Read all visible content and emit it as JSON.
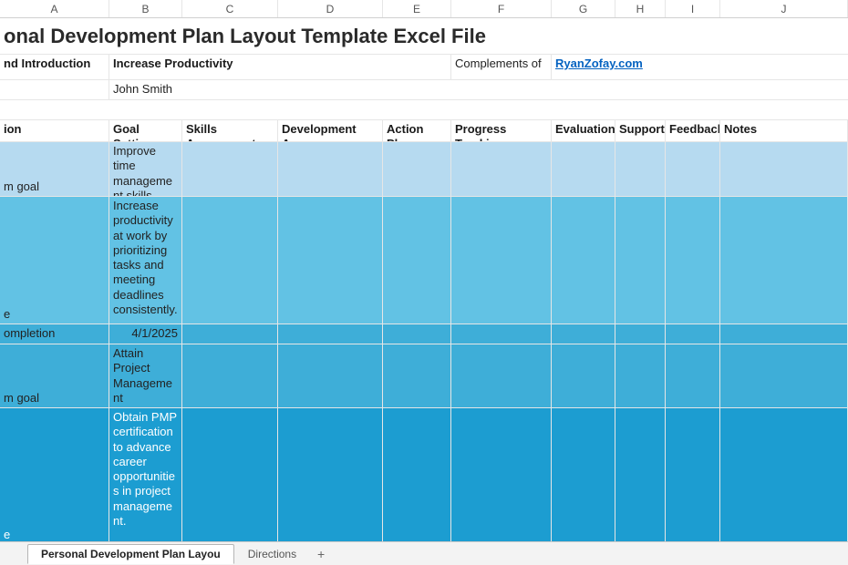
{
  "columns": [
    "A",
    "B",
    "C",
    "D",
    "E",
    "F",
    "G",
    "H",
    "I",
    "J"
  ],
  "title": "onal Development Plan Layout Template Excel File",
  "row2": {
    "a": "nd Introduction",
    "b": "Increase Productivity",
    "f": "Complements of",
    "g": "RyanZofay.com"
  },
  "row3": {
    "b": "John Smith"
  },
  "headers": {
    "a": "ion",
    "b": "Goal Setting",
    "c": "Skills Assessment",
    "d": "Development Areas",
    "e": "Action Plan",
    "f": "Progress Tracking",
    "g": "Evaluation",
    "h": "Support",
    "i": "Feedback",
    "j": "Notes"
  },
  "rows": {
    "r1": {
      "a": "m goal",
      "b": "Improve time management skills"
    },
    "r2": {
      "a": "e",
      "b": "Increase productivity at work by prioritizing tasks and meeting deadlines consistently."
    },
    "r3": {
      "a": "ompletion",
      "b": "4/1/2025"
    },
    "r4": {
      "a": "m goal",
      "b": "Attain Project Management Certification (PMP)"
    },
    "r5": {
      "a": "e",
      "b": "Obtain PMP certification to advance career opportunities in project management."
    }
  },
  "tabs": {
    "active": "Personal Development Plan Layou",
    "second": "Directions",
    "add": "+"
  }
}
